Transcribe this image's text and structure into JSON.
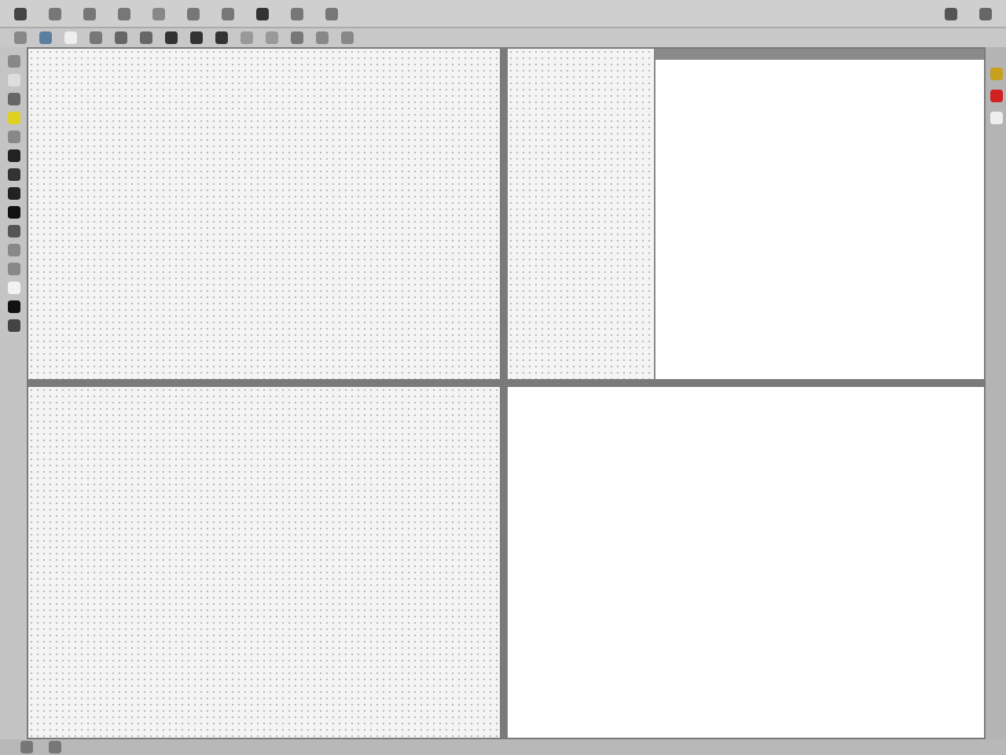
{
  "panes": [
    {
      "kind": "dotted"
    },
    {
      "kind": "split"
    },
    {
      "kind": "dotted"
    },
    {
      "kind": "blank"
    }
  ]
}
